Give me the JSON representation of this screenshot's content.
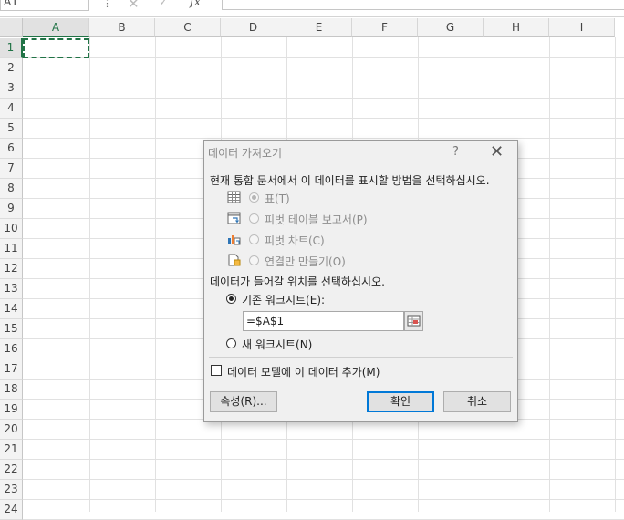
{
  "formula_bar": {
    "name_box": "A1",
    "fx": "fx",
    "separator": "⋮",
    "cancel_glyph": "✕",
    "enter_glyph": "✓"
  },
  "columns": [
    "A",
    "B",
    "C",
    "D",
    "E",
    "F",
    "G",
    "H",
    "I"
  ],
  "rows": [
    "1",
    "2",
    "3",
    "4",
    "5",
    "6",
    "7",
    "8",
    "9",
    "10",
    "11",
    "12",
    "13",
    "14",
    "15",
    "16",
    "17",
    "18",
    "19",
    "20",
    "21",
    "22",
    "23",
    "24"
  ],
  "selected_cell": "A1",
  "dialog": {
    "title": "데이터 가져오기",
    "help": "?",
    "close": "✕",
    "prompt_view": "현재 통합 문서에서 이 데이터를 표시할 방법을 선택하십시오.",
    "view_options": [
      {
        "label": "표(T)",
        "icon": "table-icon",
        "selected": true
      },
      {
        "label": "피벗 테이블 보고서(P)",
        "icon": "pivottable-icon",
        "selected": false
      },
      {
        "label": "피벗 차트(C)",
        "icon": "pivotchart-icon",
        "selected": false
      },
      {
        "label": "연결만 만들기(O)",
        "icon": "connection-icon",
        "selected": false
      }
    ],
    "prompt_location": "데이터가 들어갈 위치를 선택하십시오.",
    "existing_label": "기존 워크시트(E):",
    "existing_selected": true,
    "reference": "=$A$1",
    "new_label": "새 워크시트(N)",
    "datamodel_label": "데이터 모델에 이 데이터 추가(M)",
    "datamodel_checked": false,
    "properties_button": "속성(R)...",
    "ok_button": "확인",
    "cancel_button": "취소"
  },
  "colors": {
    "accent": "#217346",
    "default_button_border": "#0078d7"
  }
}
